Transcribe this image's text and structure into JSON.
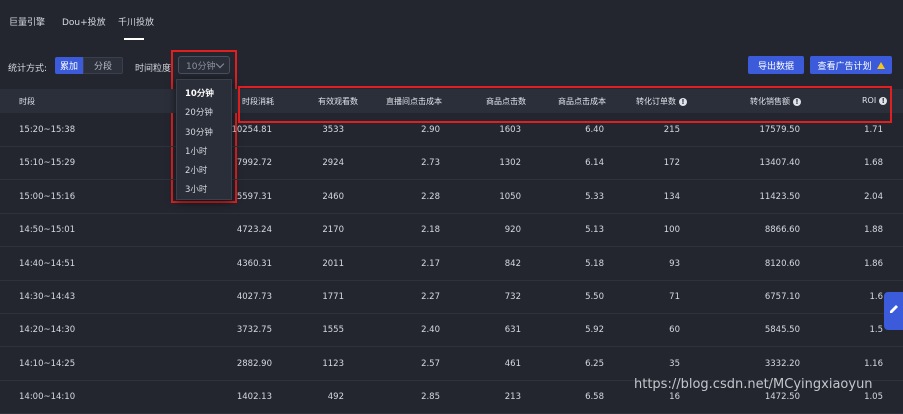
{
  "tabs": [
    {
      "label": "巨量引擎"
    },
    {
      "label": "Dou+投放"
    },
    {
      "label": "千川投放"
    }
  ],
  "controls": {
    "stat_label": "统计方式:",
    "seg_cumulative": "累加",
    "seg_segment": "分段",
    "granularity_label": "时间粒度",
    "granularity_value": "10分钟",
    "export_button": "导出数据",
    "view_plan_button": "查看广告计划"
  },
  "dropdown": {
    "options": [
      "10分钟",
      "20分钟",
      "30分钟",
      "1小时",
      "2小时",
      "3小时"
    ],
    "selected": "10分钟"
  },
  "table": {
    "headers": [
      "时段",
      "时段消耗",
      "有效观看数",
      "直播间点击成本",
      "商品点击数",
      "商品点击成本",
      "转化订单数",
      "转化销售额",
      "ROI"
    ],
    "rows": [
      [
        "15:20~15:38",
        "10254.81",
        "3533",
        "2.90",
        "1603",
        "6.40",
        "215",
        "17579.50",
        "1.71"
      ],
      [
        "15:10~15:29",
        "7992.72",
        "2924",
        "2.73",
        "1302",
        "6.14",
        "172",
        "13407.40",
        "1.68"
      ],
      [
        "15:00~15:16",
        "5597.31",
        "2460",
        "2.28",
        "1050",
        "5.33",
        "134",
        "11423.50",
        "2.04"
      ],
      [
        "14:50~15:01",
        "4723.24",
        "2170",
        "2.18",
        "920",
        "5.13",
        "100",
        "8866.60",
        "1.88"
      ],
      [
        "14:40~14:51",
        "4360.31",
        "2011",
        "2.17",
        "842",
        "5.18",
        "93",
        "8120.60",
        "1.86"
      ],
      [
        "14:30~14:43",
        "4027.73",
        "1771",
        "2.27",
        "732",
        "5.50",
        "71",
        "6757.10",
        "1.6"
      ],
      [
        "14:20~14:30",
        "3732.75",
        "1555",
        "2.40",
        "631",
        "5.92",
        "60",
        "5845.50",
        "1.5"
      ],
      [
        "14:10~14:25",
        "2882.90",
        "1123",
        "2.57",
        "461",
        "6.25",
        "35",
        "3332.20",
        "1.16"
      ],
      [
        "14:00~14:10",
        "1402.13",
        "492",
        "2.85",
        "213",
        "6.58",
        "16",
        "1472.50",
        "1.05"
      ]
    ]
  },
  "watermark": "https://blog.csdn.net/MCyingxiaoyun",
  "colors": {
    "background": "#23262f",
    "header_bg": "#2b2f3a",
    "accent": "#3b5bdb",
    "highlight": "#e02020",
    "warning": "#f5c518"
  },
  "icons": {
    "warning": "warning-triangle-icon",
    "info": "info-circle-icon",
    "chevron": "chevron-down-icon",
    "side": "edit-pen-icon"
  }
}
